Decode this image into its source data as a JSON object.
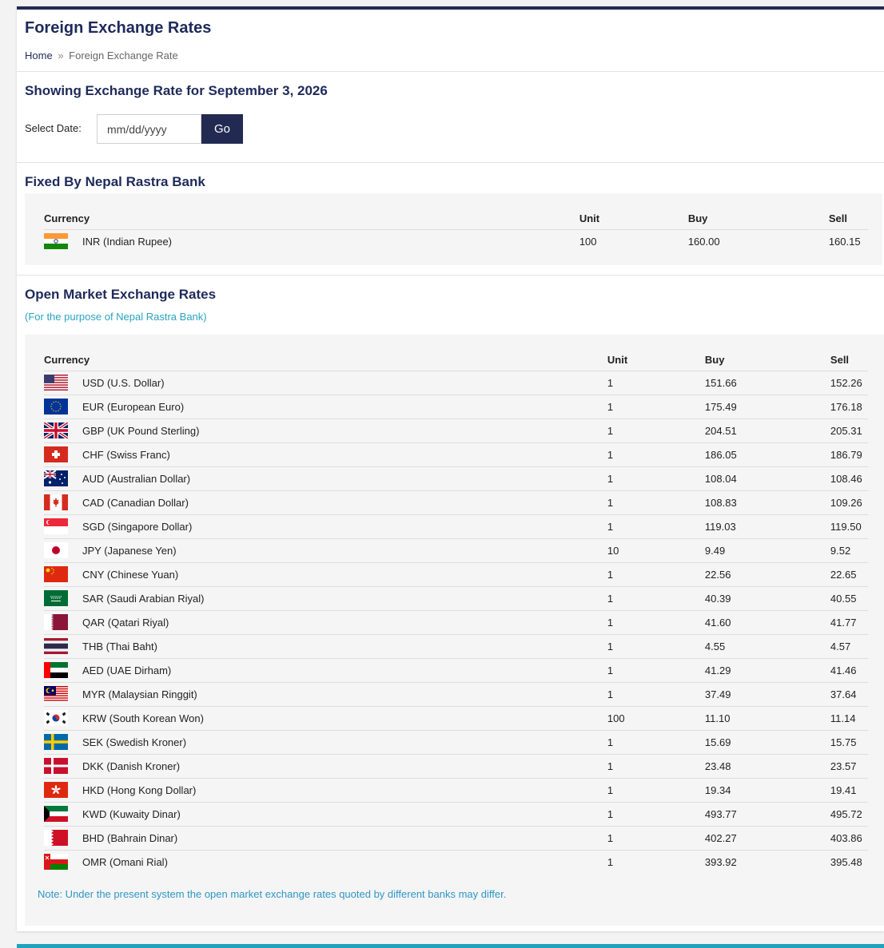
{
  "page": {
    "title": "Foreign Exchange Rates",
    "breadcrumb": {
      "home": "Home",
      "separator": "»",
      "current": "Foreign Exchange Rate"
    }
  },
  "date_section": {
    "heading": "Showing Exchange Rate for September 3, 2026",
    "select_label": "Select Date:",
    "date_placeholder": "mm/dd/yyyy",
    "go_label": "Go"
  },
  "fixed": {
    "heading": "Fixed By Nepal Rastra Bank",
    "columns": [
      "Currency",
      "Unit",
      "Buy",
      "Sell"
    ],
    "rows": [
      {
        "flag": "in-flag-icon",
        "currency": "INR (Indian Rupee)",
        "unit": "100",
        "buy": "160.00",
        "sell": "160.15"
      }
    ]
  },
  "open_market": {
    "heading": "Open Market Exchange Rates",
    "subheading": "(For the purpose of Nepal Rastra Bank)",
    "columns": [
      "Currency",
      "Unit",
      "Buy",
      "Sell"
    ],
    "rows": [
      {
        "flag": "us-flag-icon",
        "currency": "USD (U.S. Dollar)",
        "unit": "1",
        "buy": "151.66",
        "sell": "152.26"
      },
      {
        "flag": "eu-flag-icon",
        "currency": "EUR (European Euro)",
        "unit": "1",
        "buy": "175.49",
        "sell": "176.18"
      },
      {
        "flag": "gb-flag-icon",
        "currency": "GBP (UK Pound Sterling)",
        "unit": "1",
        "buy": "204.51",
        "sell": "205.31"
      },
      {
        "flag": "ch-flag-icon",
        "currency": "CHF (Swiss Franc)",
        "unit": "1",
        "buy": "186.05",
        "sell": "186.79"
      },
      {
        "flag": "au-flag-icon",
        "currency": "AUD (Australian Dollar)",
        "unit": "1",
        "buy": "108.04",
        "sell": "108.46"
      },
      {
        "flag": "ca-flag-icon",
        "currency": "CAD (Canadian Dollar)",
        "unit": "1",
        "buy": "108.83",
        "sell": "109.26"
      },
      {
        "flag": "sg-flag-icon",
        "currency": "SGD (Singapore Dollar)",
        "unit": "1",
        "buy": "119.03",
        "sell": "119.50"
      },
      {
        "flag": "jp-flag-icon",
        "currency": "JPY (Japanese Yen)",
        "unit": "10",
        "buy": "9.49",
        "sell": "9.52"
      },
      {
        "flag": "cn-flag-icon",
        "currency": "CNY (Chinese Yuan)",
        "unit": "1",
        "buy": "22.56",
        "sell": "22.65"
      },
      {
        "flag": "sa-flag-icon",
        "currency": "SAR (Saudi Arabian Riyal)",
        "unit": "1",
        "buy": "40.39",
        "sell": "40.55"
      },
      {
        "flag": "qa-flag-icon",
        "currency": "QAR (Qatari Riyal)",
        "unit": "1",
        "buy": "41.60",
        "sell": "41.77"
      },
      {
        "flag": "th-flag-icon",
        "currency": "THB (Thai Baht)",
        "unit": "1",
        "buy": "4.55",
        "sell": "4.57"
      },
      {
        "flag": "ae-flag-icon",
        "currency": "AED (UAE Dirham)",
        "unit": "1",
        "buy": "41.29",
        "sell": "41.46"
      },
      {
        "flag": "my-flag-icon",
        "currency": "MYR (Malaysian Ringgit)",
        "unit": "1",
        "buy": "37.49",
        "sell": "37.64"
      },
      {
        "flag": "kr-flag-icon",
        "currency": "KRW (South Korean Won)",
        "unit": "100",
        "buy": "11.10",
        "sell": "11.14"
      },
      {
        "flag": "se-flag-icon",
        "currency": "SEK (Swedish Kroner)",
        "unit": "1",
        "buy": "15.69",
        "sell": "15.75"
      },
      {
        "flag": "dk-flag-icon",
        "currency": "DKK (Danish Kroner)",
        "unit": "1",
        "buy": "23.48",
        "sell": "23.57"
      },
      {
        "flag": "hk-flag-icon",
        "currency": "HKD (Hong Kong Dollar)",
        "unit": "1",
        "buy": "19.34",
        "sell": "19.41"
      },
      {
        "flag": "kw-flag-icon",
        "currency": "KWD (Kuwaity Dinar)",
        "unit": "1",
        "buy": "493.77",
        "sell": "495.72"
      },
      {
        "flag": "bh-flag-icon",
        "currency": "BHD (Bahrain Dinar)",
        "unit": "1",
        "buy": "402.27",
        "sell": "403.86"
      },
      {
        "flag": "om-flag-icon",
        "currency": "OMR (Omani Rial)",
        "unit": "1",
        "buy": "393.92",
        "sell": "395.48"
      }
    ],
    "note": "Note: Under the present system the open market exchange rates quoted by different banks may differ."
  },
  "colors": {
    "navy": "#232a52",
    "teal": "#22a3bd",
    "note_blue": "#2e97c6"
  }
}
